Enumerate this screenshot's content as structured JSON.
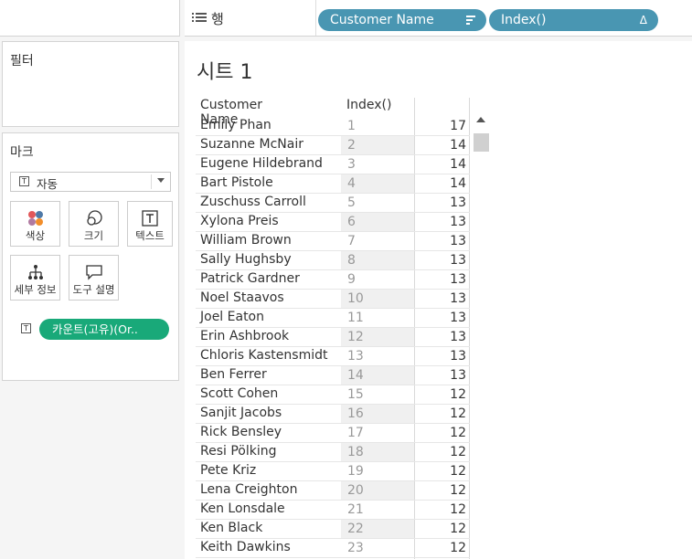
{
  "shelf": {
    "label": "행",
    "pills": [
      {
        "label": "Customer Name",
        "icon": "sort-desc-icon"
      },
      {
        "label": "Index()",
        "icon": "delta-icon",
        "symbol": "Δ"
      }
    ]
  },
  "filters": {
    "title": "필터"
  },
  "marks": {
    "title": "마크",
    "type": "자동",
    "buttons": [
      {
        "label": "색상",
        "icon": "color-icon"
      },
      {
        "label": "크기",
        "icon": "size-icon"
      },
      {
        "label": "텍스트",
        "icon": "text-icon"
      },
      {
        "label": "세부 정보",
        "icon": "detail-icon"
      },
      {
        "label": "도구 설명",
        "icon": "tooltip-icon"
      }
    ],
    "pill": "카운트(고유)(Or.."
  },
  "sheet": {
    "title": "시트 1",
    "columns": [
      "Customer Name",
      "Index()"
    ],
    "rows": [
      {
        "name": "Emily Phan",
        "index": "1",
        "count": "17"
      },
      {
        "name": "Suzanne McNair",
        "index": "2",
        "count": "14"
      },
      {
        "name": "Eugene Hildebrand",
        "index": "3",
        "count": "14"
      },
      {
        "name": "Bart Pistole",
        "index": "4",
        "count": "14"
      },
      {
        "name": "Zuschuss Carroll",
        "index": "5",
        "count": "13"
      },
      {
        "name": "Xylona Preis",
        "index": "6",
        "count": "13"
      },
      {
        "name": "William Brown",
        "index": "7",
        "count": "13"
      },
      {
        "name": "Sally Hughsby",
        "index": "8",
        "count": "13"
      },
      {
        "name": "Patrick Gardner",
        "index": "9",
        "count": "13"
      },
      {
        "name": "Noel Staavos",
        "index": "10",
        "count": "13"
      },
      {
        "name": "Joel Eaton",
        "index": "11",
        "count": "13"
      },
      {
        "name": "Erin Ashbrook",
        "index": "12",
        "count": "13"
      },
      {
        "name": "Chloris Kastensmidt",
        "index": "13",
        "count": "13"
      },
      {
        "name": "Ben Ferrer",
        "index": "14",
        "count": "13"
      },
      {
        "name": "Scott Cohen",
        "index": "15",
        "count": "12"
      },
      {
        "name": "Sanjit Jacobs",
        "index": "16",
        "count": "12"
      },
      {
        "name": "Rick Bensley",
        "index": "17",
        "count": "12"
      },
      {
        "name": "Resi Pölking",
        "index": "18",
        "count": "12"
      },
      {
        "name": "Pete Kriz",
        "index": "19",
        "count": "12"
      },
      {
        "name": "Lena Creighton",
        "index": "20",
        "count": "12"
      },
      {
        "name": "Ken Lonsdale",
        "index": "21",
        "count": "12"
      },
      {
        "name": "Ken Black",
        "index": "22",
        "count": "12"
      },
      {
        "name": "Keith Dawkins",
        "index": "23",
        "count": "12"
      }
    ]
  },
  "colors": {
    "shelf_pill": "#4996b2",
    "marks_pill": "#19a979",
    "index_shade": "#f0f0f0"
  }
}
